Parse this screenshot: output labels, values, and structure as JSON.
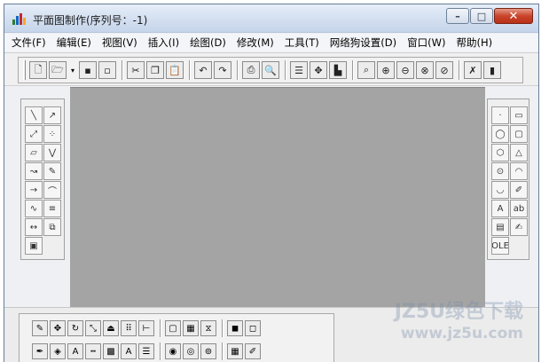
{
  "window": {
    "title": "平面图制作(序列号：-1)",
    "app_icon": "chart-app-icon",
    "controls": {
      "minimize": "–",
      "maximize": "□",
      "close": "✕"
    }
  },
  "menu": [
    "文件(F)",
    "编辑(E)",
    "视图(V)",
    "插入(I)",
    "绘图(D)",
    "修改(M)",
    "工具(T)",
    "网络狗设置(D)",
    "窗口(W)",
    "帮助(H)"
  ],
  "toolbar": {
    "buttons": [
      {
        "name": "new-icon",
        "glyph": "🗋"
      },
      {
        "name": "open-icon",
        "glyph": "🗁"
      },
      {
        "name": "dropdown-icon",
        "glyph": "▾"
      },
      {
        "name": "save-icon",
        "glyph": "▪"
      },
      {
        "name": "save-all-icon",
        "glyph": "▫"
      },
      {
        "name": "cut-icon",
        "glyph": "✂"
      },
      {
        "name": "copy-icon",
        "glyph": "❐"
      },
      {
        "name": "paste-icon",
        "glyph": "📋"
      },
      {
        "name": "undo-icon",
        "glyph": "↶"
      },
      {
        "name": "redo-icon",
        "glyph": "↷"
      },
      {
        "name": "print-icon",
        "glyph": "⎙"
      },
      {
        "name": "print-preview-icon",
        "glyph": "🔍"
      },
      {
        "name": "layer-icon",
        "glyph": "☰"
      },
      {
        "name": "pan-icon",
        "glyph": "✥"
      },
      {
        "name": "chart-icon",
        "glyph": "▙"
      },
      {
        "name": "zoom-window-icon",
        "glyph": "⌕"
      },
      {
        "name": "zoom-realtime-icon",
        "glyph": "⊕"
      },
      {
        "name": "zoom-previous-icon",
        "glyph": "⊖"
      },
      {
        "name": "zoom-all-icon",
        "glyph": "⊗"
      },
      {
        "name": "zoom-extents-icon",
        "glyph": "⊘"
      },
      {
        "name": "delete-icon",
        "glyph": "✗"
      },
      {
        "name": "properties-icon",
        "glyph": "▮"
      }
    ]
  },
  "left_palette": [
    {
      "name": "line-icon",
      "glyph": "╲"
    },
    {
      "name": "ray-icon",
      "glyph": "↗"
    },
    {
      "name": "xline-icon",
      "glyph": "⤢"
    },
    {
      "name": "points-icon",
      "glyph": "⁘"
    },
    {
      "name": "eraser-icon",
      "glyph": "▱"
    },
    {
      "name": "polyline-icon",
      "glyph": "⋁"
    },
    {
      "name": "curve-icon",
      "glyph": "↝"
    },
    {
      "name": "pencil-icon",
      "glyph": "✎"
    },
    {
      "name": "arrow-icon",
      "glyph": "→"
    },
    {
      "name": "arc-icon",
      "glyph": "⌒"
    },
    {
      "name": "wave-icon",
      "glyph": "∿"
    },
    {
      "name": "hatch-icon",
      "glyph": "≡"
    },
    {
      "name": "dimension-icon",
      "glyph": "↔"
    },
    {
      "name": "insert-block-icon",
      "glyph": "⧉"
    },
    {
      "name": "image-icon",
      "glyph": "▣"
    }
  ],
  "right_palette": [
    {
      "name": "point-icon",
      "glyph": "·"
    },
    {
      "name": "rectangle-icon",
      "glyph": "▭"
    },
    {
      "name": "circle-icon",
      "glyph": "◯"
    },
    {
      "name": "rounded-rect-icon",
      "glyph": "▢"
    },
    {
      "name": "polygon-icon",
      "glyph": "⬡"
    },
    {
      "name": "triangle-icon",
      "glyph": "△"
    },
    {
      "name": "ellipse-icon",
      "glyph": "⊙"
    },
    {
      "name": "semicircle-icon",
      "glyph": "◠"
    },
    {
      "name": "arc-shape-icon",
      "glyph": "◡"
    },
    {
      "name": "edit-icon",
      "glyph": "✐"
    },
    {
      "name": "text-style-icon",
      "glyph": "A"
    },
    {
      "name": "text-icon",
      "glyph": "ab"
    },
    {
      "name": "list-icon",
      "glyph": "▤"
    },
    {
      "name": "paint-icon",
      "glyph": "✍"
    },
    {
      "name": "ole-icon",
      "glyph": "OLE"
    }
  ],
  "bottom_toolbar": {
    "row1": [
      {
        "name": "select-icon",
        "glyph": "✎"
      },
      {
        "name": "move-icon",
        "glyph": "✥"
      },
      {
        "name": "rotate-icon",
        "glyph": "↻"
      },
      {
        "name": "scale-icon",
        "glyph": "⤡"
      },
      {
        "name": "mirror-icon",
        "glyph": "⏏"
      },
      {
        "name": "array-icon",
        "glyph": "⠿"
      },
      {
        "name": "measure-icon",
        "glyph": "⊢"
      },
      {
        "name": "sep"
      },
      {
        "name": "group-icon",
        "glyph": "▢"
      },
      {
        "name": "grid-icon",
        "glyph": "▦"
      },
      {
        "name": "mirror-h-icon",
        "glyph": "⧖"
      },
      {
        "name": "sep"
      },
      {
        "name": "bring-front-icon",
        "glyph": "◼"
      },
      {
        "name": "send-back-icon",
        "glyph": "◻"
      }
    ],
    "row2": [
      {
        "name": "line-color-icon",
        "glyph": "✒"
      },
      {
        "name": "fill-color-icon",
        "glyph": "◈"
      },
      {
        "name": "font-color-icon",
        "glyph": "A"
      },
      {
        "name": "line-type-icon",
        "glyph": "┅"
      },
      {
        "name": "pattern-icon",
        "glyph": "▩"
      },
      {
        "name": "font-icon",
        "glyph": "A"
      },
      {
        "name": "line-width-icon",
        "glyph": "☰"
      },
      {
        "name": "sep"
      },
      {
        "name": "snap-icon",
        "glyph": "◉"
      },
      {
        "name": "ortho-icon",
        "glyph": "◎"
      },
      {
        "name": "osnap-icon",
        "glyph": "⊚"
      },
      {
        "name": "sep"
      },
      {
        "name": "layer-props-icon",
        "glyph": "▦"
      },
      {
        "name": "match-props-icon",
        "glyph": "✐"
      }
    ]
  },
  "watermark": {
    "line1": "JZ5U绿色下载",
    "line2": "www.jz5u.com"
  }
}
